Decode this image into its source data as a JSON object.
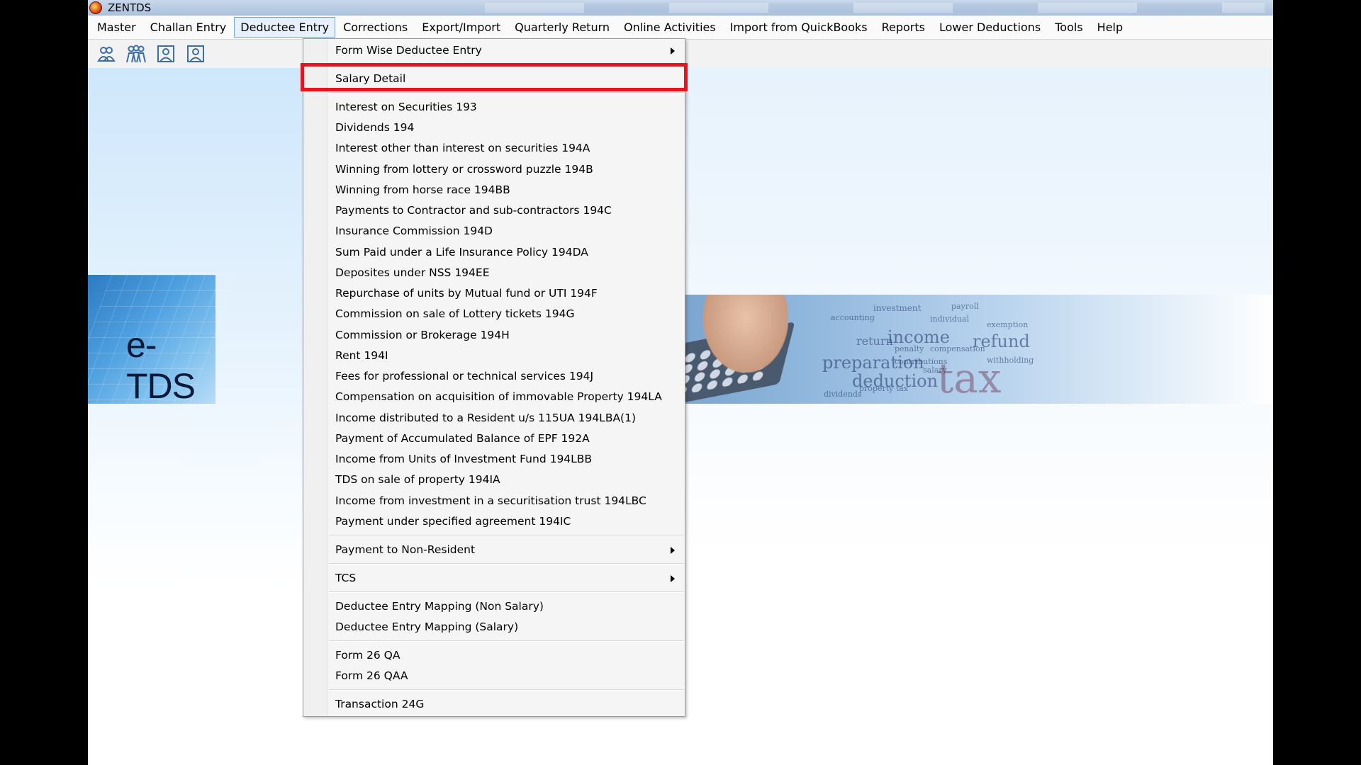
{
  "window": {
    "title": "ZENTDS"
  },
  "menubar": {
    "items": [
      {
        "label": "Master"
      },
      {
        "label": "Challan Entry"
      },
      {
        "label": "Deductee Entry"
      },
      {
        "label": "Corrections"
      },
      {
        "label": "Export/Import"
      },
      {
        "label": "Quarterly Return"
      },
      {
        "label": "Online Activities"
      },
      {
        "label": "Import from QuickBooks"
      },
      {
        "label": "Reports"
      },
      {
        "label": "Lower Deductions"
      },
      {
        "label": "Tools"
      },
      {
        "label": "Help"
      }
    ]
  },
  "toolbar": {
    "icons": [
      "users-icon",
      "group-icon",
      "user-card-icon",
      "user-card-icon"
    ]
  },
  "banner": {
    "left_text": "e-TDS",
    "wordcloud": [
      "income",
      "refund",
      "preparation",
      "deduction",
      "tax",
      "investment",
      "return",
      "salary",
      "penalty",
      "compensation",
      "exemption",
      "contributions",
      "withholding",
      "dividends",
      "property tax",
      "individual",
      "accounting",
      "payroll"
    ]
  },
  "dropdown": {
    "items": [
      {
        "label": "Form Wise Deductee Entry",
        "submenu": true
      },
      {
        "label": "Salary Detail",
        "highlighted": true
      },
      {
        "label": "Interest on Securities 193"
      },
      {
        "label": "Dividends 194"
      },
      {
        "label": "Interest other than interest on securities 194A"
      },
      {
        "label": "Winning from lottery  or crossword puzzle 194B"
      },
      {
        "label": "Winning from horse race 194BB"
      },
      {
        "label": "Payments to Contractor and sub-contractors 194C"
      },
      {
        "label": "Insurance Commission 194D"
      },
      {
        "label": "Sum Paid under a Life Insurance Policy 194DA"
      },
      {
        "label": "Deposites under NSS 194EE"
      },
      {
        "label": "Repurchase of units by Mutual fund or UTI 194F"
      },
      {
        "label": "Commission on sale of Lottery tickets 194G"
      },
      {
        "label": "Commission or Brokerage 194H"
      },
      {
        "label": "Rent 194I"
      },
      {
        "label": "Fees for professional or technical services 194J"
      },
      {
        "label": "Compensation on acquisition of immovable Property 194LA"
      },
      {
        "label": "Income distributed to a Resident u/s 115UA 194LBA(1)"
      },
      {
        "label": "Payment of Accumulated Balance of EPF 192A"
      },
      {
        "label": "Income from Units of Investment Fund 194LBB"
      },
      {
        "label": "TDS on sale of property 194IA"
      },
      {
        "label": "Income from investment in a securitisation trust 194LBC"
      },
      {
        "label": "Payment under specified agreement 194IC"
      },
      {
        "label": "Payment to Non-Resident",
        "submenu": true
      },
      {
        "label": "TCS",
        "submenu": true
      },
      {
        "label": "Deductee Entry Mapping (Non Salary)"
      },
      {
        "label": "Deductee Entry Mapping (Salary)"
      },
      {
        "label": "Form 26 QA"
      },
      {
        "label": "Form 26 QAA"
      },
      {
        "label": "Transaction 24G"
      }
    ]
  },
  "colors": {
    "highlight": "#e8141c",
    "active_menu": "#e8f1fb"
  }
}
